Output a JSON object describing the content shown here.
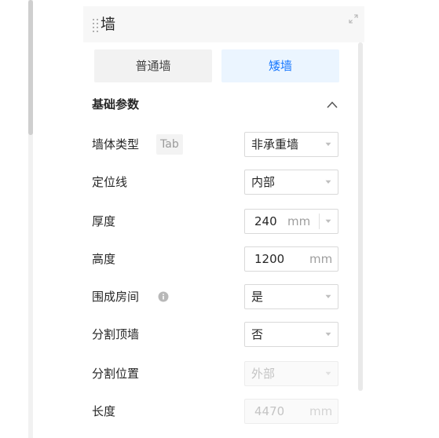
{
  "panel": {
    "title": "墙"
  },
  "wall_type_tabs": [
    {
      "label": "普通墙",
      "active": false
    },
    {
      "label": "矮墙",
      "active": true
    }
  ],
  "section": {
    "title": "基础参数"
  },
  "rows": {
    "wall_category": {
      "label": "墙体类型",
      "badge": "Tab",
      "value": "非承重墙"
    },
    "position_line": {
      "label": "定位线",
      "value": "内部"
    },
    "thickness": {
      "label": "厚度",
      "value": "240",
      "unit": "mm"
    },
    "height": {
      "label": "高度",
      "value": "1200",
      "unit": "mm"
    },
    "enclose_room": {
      "label": "围成房间",
      "value": "是"
    },
    "split_ceiling": {
      "label": "分割顶墙",
      "value": "否"
    },
    "split_position": {
      "label": "分割位置",
      "value": "外部"
    },
    "length": {
      "label": "长度",
      "value": "4470",
      "unit": "mm"
    }
  },
  "colors": {
    "accent": "#1677ff",
    "active_tab_bg": "#ebf5ff",
    "inactive_tab_bg": "#f2f2f2"
  },
  "icons": [
    "drag-handle-icon",
    "expand-icon",
    "chevron-up-icon",
    "info-icon",
    "chevron-down-icon"
  ]
}
